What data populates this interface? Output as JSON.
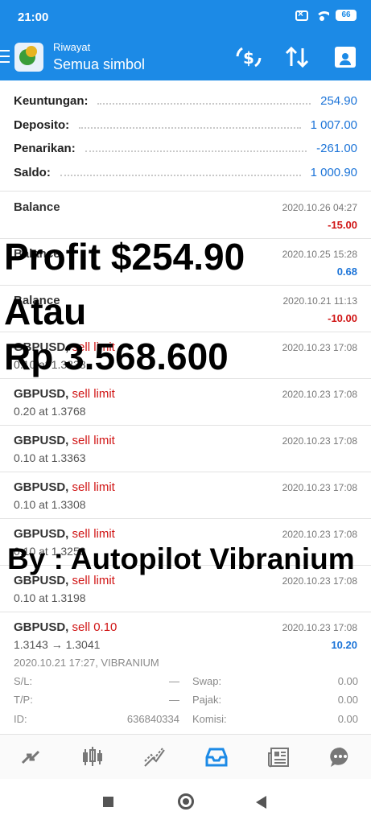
{
  "status_bar": {
    "time": "21:00",
    "battery": "66"
  },
  "app_bar": {
    "subtitle": "Riwayat",
    "title": "Semua simbol"
  },
  "summary": [
    {
      "label": "Keuntungan:",
      "value": "254.90"
    },
    {
      "label": "Deposito:",
      "value": "1 007.00"
    },
    {
      "label": "Penarikan:",
      "value": "-261.00"
    },
    {
      "label": "Saldo:",
      "value": "1 000.90"
    }
  ],
  "deals": [
    {
      "symbol": "Balance",
      "type": "",
      "info": "",
      "datetime": "2020.10.26 04:27",
      "amount": "-15.00",
      "amount_sign": "neg"
    },
    {
      "symbol": "Balance",
      "type": "",
      "info": "",
      "datetime": "2020.10.25 15:28",
      "amount": "0.68",
      "amount_sign": "pos"
    },
    {
      "symbol": "Balance",
      "type": "",
      "info": "",
      "datetime": "2020.10.21 11:13",
      "amount": "-10.00",
      "amount_sign": "neg"
    },
    {
      "symbol": "GBPUSD,",
      "type": "sell limit",
      "info": "0.10 at 1.3838",
      "datetime": "2020.10.23 17:08",
      "amount": "",
      "amount_sign": ""
    },
    {
      "symbol": "GBPUSD,",
      "type": "sell limit",
      "info": "0.20 at 1.3768",
      "datetime": "2020.10.23 17:08",
      "amount": "",
      "amount_sign": ""
    },
    {
      "symbol": "GBPUSD,",
      "type": "sell limit",
      "info": "0.10 at 1.3363",
      "datetime": "2020.10.23 17:08",
      "amount": "",
      "amount_sign": ""
    },
    {
      "symbol": "GBPUSD,",
      "type": "sell limit",
      "info": "0.10 at 1.3308",
      "datetime": "2020.10.23 17:08",
      "amount": "",
      "amount_sign": ""
    },
    {
      "symbol": "GBPUSD,",
      "type": "sell limit",
      "info": "0.10 at 1.3253",
      "datetime": "2020.10.23 17:08",
      "amount": "",
      "amount_sign": ""
    },
    {
      "symbol": "GBPUSD,",
      "type": "sell limit",
      "info": "0.10 at 1.3198",
      "datetime": "2020.10.23 17:08",
      "amount": "",
      "amount_sign": ""
    },
    {
      "symbol": "GBPUSD,",
      "type": "sell 0.10",
      "info": "1.3143 → 1.3041",
      "datetime": "2020.10.23 17:08",
      "amount": "10.20",
      "amount_sign": "pos"
    }
  ],
  "detail": {
    "meta": "2020.10.21 17:27, VIBRANIUM",
    "sl_label": "S/L:",
    "sl_value": "—",
    "tp_label": "T/P:",
    "tp_value": "—",
    "id_label": "ID:",
    "id_value": "636840334",
    "swap_label": "Swap:",
    "swap_value": "0.00",
    "tax_label": "Pajak:",
    "tax_value": "0.00",
    "commission_label": "Komisi:",
    "commission_value": "0.00"
  },
  "bottom_nav": [
    "quotes-icon",
    "chart-icon",
    "trade-icon",
    "history-icon",
    "news-icon",
    "chat-icon"
  ],
  "overlay": {
    "line1": "Profit $254.90",
    "line2": "Atau",
    "line3": "Rp 3.568.600",
    "line4": "By : Autopilot Vibranium"
  },
  "colors": {
    "accent": "#1c8ae6",
    "negative": "#d01515",
    "positive": "#1c74d8"
  }
}
